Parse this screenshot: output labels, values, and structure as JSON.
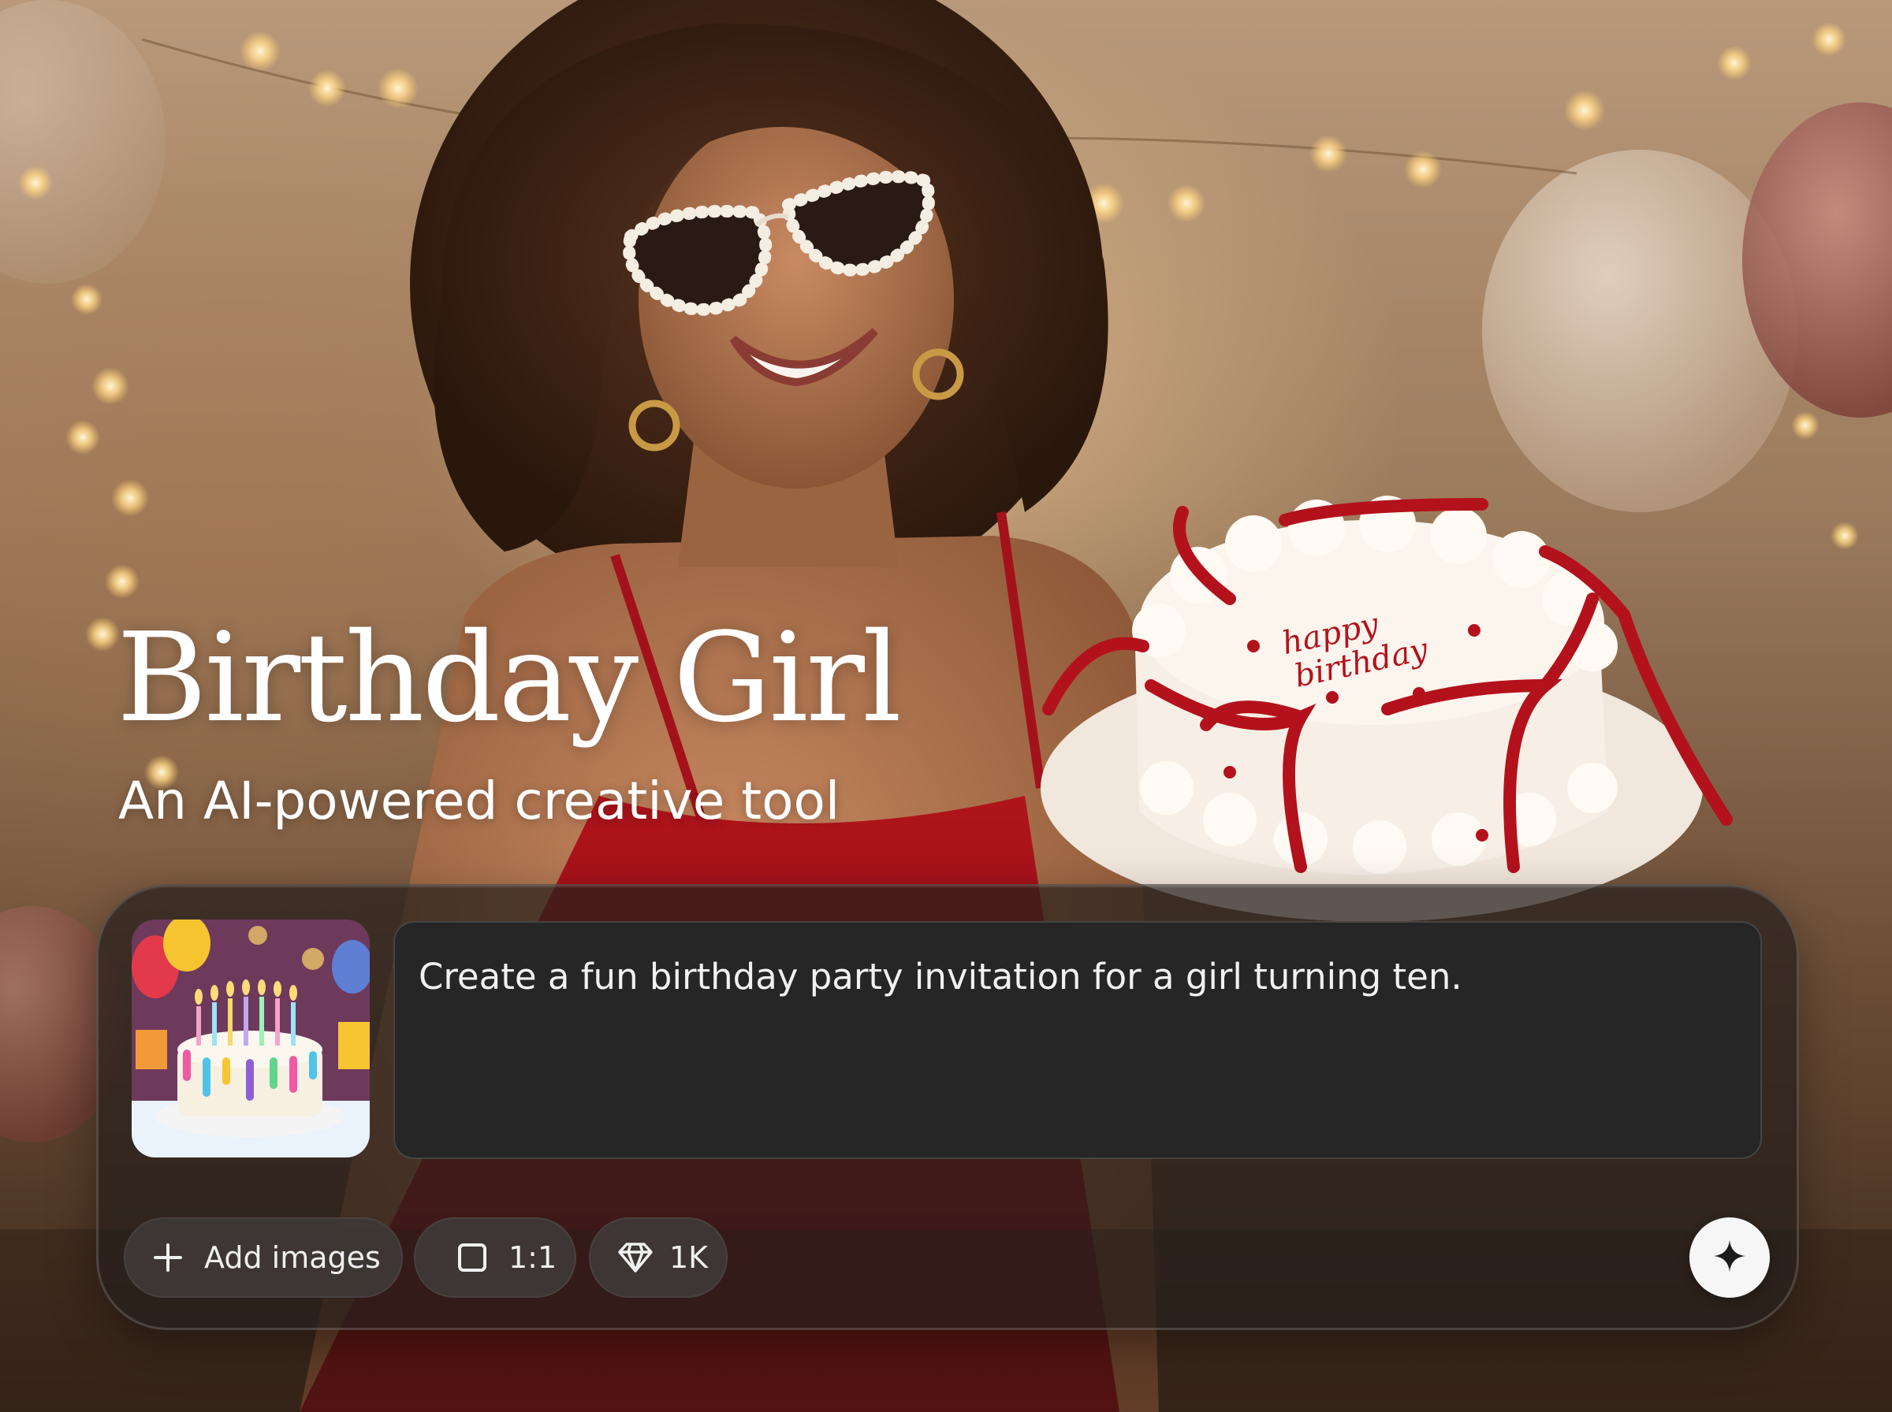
{
  "hero": {
    "title": "Birthday Girl",
    "subtitle": "An AI-powered creative tool"
  },
  "panel": {
    "thumbnail_icon": "birthday-cake-image",
    "prompt": "Create a fun birthday party invitation for a girl turning ten.",
    "chips": {
      "add_images": "Add images",
      "aspect_ratio": "1:1",
      "resolution": "1K"
    },
    "generate_icon": "sparkle-icon"
  },
  "cake_text": "happy birthday",
  "colors": {
    "panel_bg": "#261e1c",
    "prompt_bg": "#262626",
    "chip_bg": "#3e3836",
    "button_bg": "#f6f6f6",
    "text": "#ffffff",
    "ribbon": "#b3121c"
  }
}
